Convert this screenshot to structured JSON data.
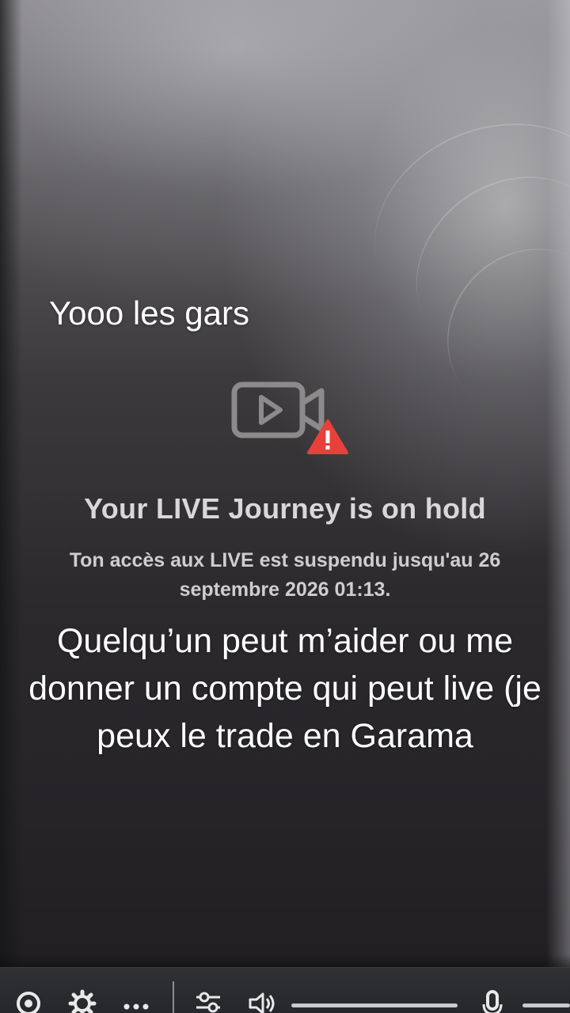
{
  "overlay": {
    "top_caption": "Yooo les gars",
    "main_caption": "Quelqu’un peut m’aider ou me donner un compte qui peut live (je peux le trade en Garama"
  },
  "screen": {
    "icon": "video-camera-warning-icon",
    "title": "Your LIVE Journey is on hold",
    "subtitle": "Ton accès aux LIVE est suspendu jusqu'au 26 septembre 2026 01:13."
  },
  "taskbar": {
    "icons": [
      "record-icon",
      "settings-icon",
      "more-icon",
      "equalizer-icon",
      "volume-icon",
      "microphone-icon"
    ]
  },
  "colors": {
    "warning": "#e8403a",
    "caption_text": "#ffffff",
    "screen_text": "#d9d7d8"
  }
}
